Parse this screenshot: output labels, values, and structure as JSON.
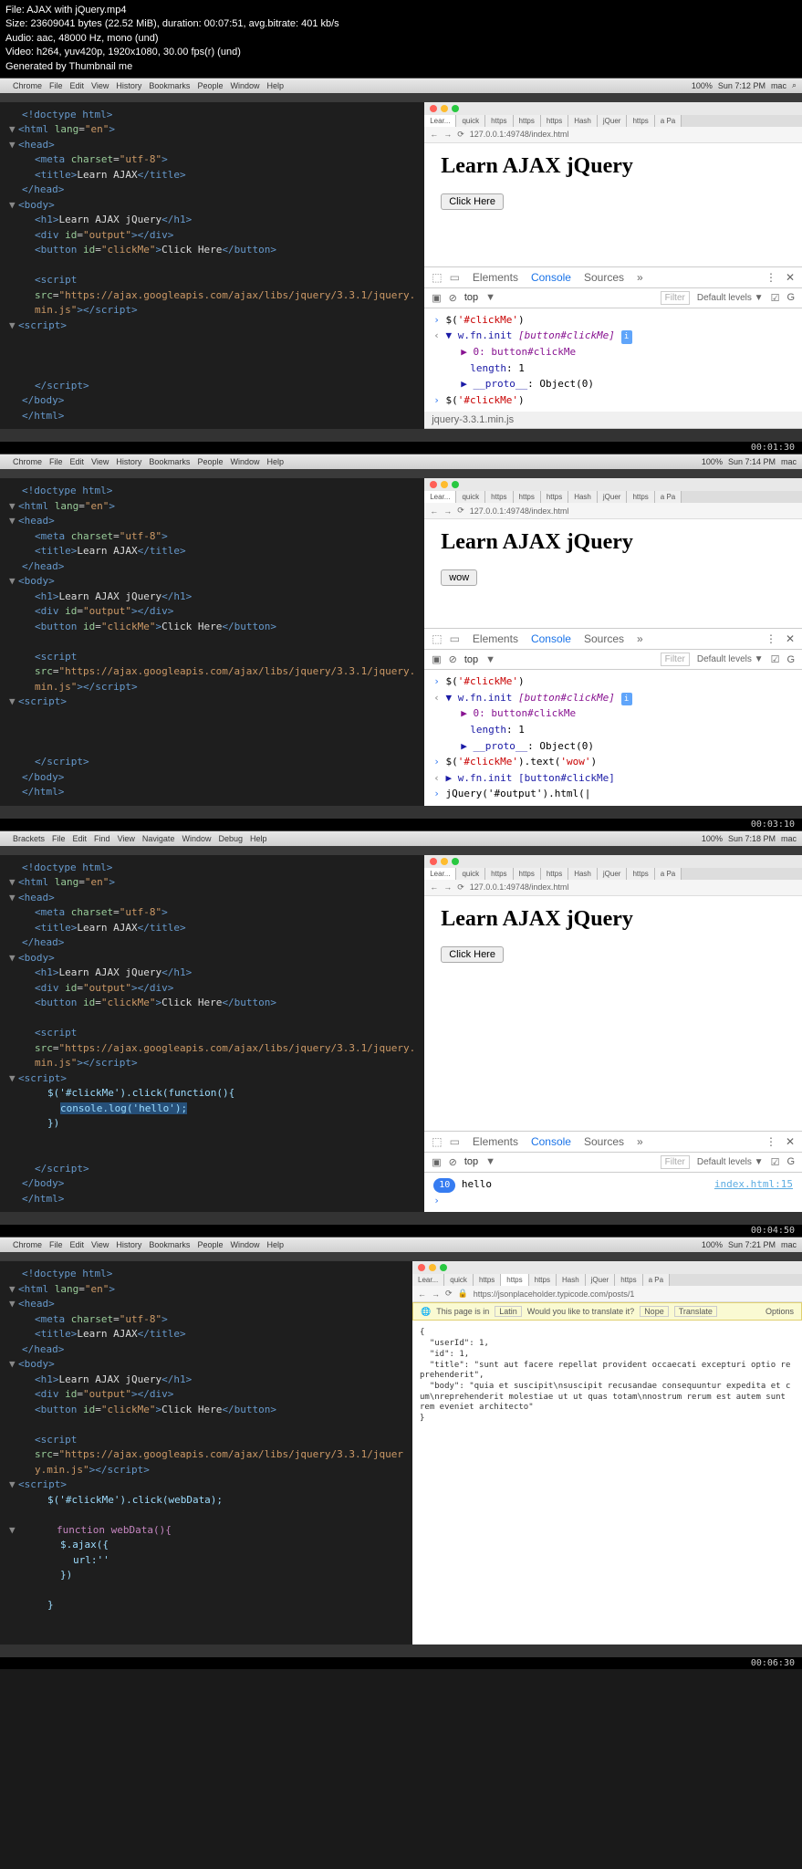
{
  "header": {
    "file": "File: AJAX with jQuery.mp4",
    "size": "Size: 23609041 bytes (22.52 MiB), duration: 00:07:51, avg.bitrate: 401 kb/s",
    "audio": "Audio: aac, 48000 Hz, mono (und)",
    "video": "Video: h264, yuv420p, 1920x1080, 30.00 fps(r) (und)",
    "gen": "Generated by Thumbnail me"
  },
  "menu": {
    "apple": "",
    "items": [
      "Chrome",
      "File",
      "Edit",
      "View",
      "History",
      "Bookmarks",
      "People",
      "Window",
      "Help"
    ],
    "brackets_items": [
      "Brackets",
      "File",
      "Edit",
      "Find",
      "View",
      "Navigate",
      "Window",
      "Debug",
      "Help"
    ],
    "right_items": [
      "100%",
      "Sun 7:12 PM",
      "mac"
    ],
    "right_items2": [
      "100%",
      "Sun 7:14 PM",
      "mac"
    ],
    "right_items3": [
      "100%",
      "Sun 7:18 PM",
      "mac"
    ],
    "right_items4": [
      "100%",
      "Sun 7:21 PM",
      "mac"
    ]
  },
  "browser": {
    "tabs": [
      "Lear...",
      "quick",
      "https",
      "https",
      "https",
      "Hash",
      "jQuer",
      "https",
      "a Pa"
    ],
    "url": "127.0.0.1:49748/index.html",
    "url4": "https://jsonplaceholder.typicode.com/posts/1"
  },
  "page": {
    "h1": "Learn AJAX jQuery",
    "btn": "Click Here",
    "wow": "wow"
  },
  "devtools": {
    "elements": "Elements",
    "console": "Console",
    "sources": "Sources",
    "top": "top",
    "filter": "Filter",
    "levels": "Default levels ▼",
    "gear": "G"
  },
  "console1": {
    "l1a": "$(",
    "l1b": "'#clickMe'",
    "l1c": ")",
    "l2a": "▼ w.fn.init ",
    "l2b": "[button#clickMe]",
    "l3": "▶ 0: button#clickMe",
    "l4a": "length",
    "l4b": ": 1",
    "l5a": "▶ __proto__",
    "l5b": ": Object(0)",
    "l6a": "$(",
    "l6b": "'#clickMe'",
    "l6c": ")"
  },
  "console2": {
    "e1": "$('#clickMe').text('wow')",
    "e2": "▶ w.fn.init [button#clickMe]",
    "e3": "jQuery('#output').html(|"
  },
  "console3": {
    "count": "10",
    "msg": "hello",
    "link": "index.html:15"
  },
  "code": {
    "doctype": "<!doctype html>",
    "html_open": "html",
    "lang": "lang",
    "en": "\"en\"",
    "head": "head",
    "meta": "meta",
    "charset": "charset",
    "utf8": "\"utf-8\"",
    "title": "title",
    "title_txt": "Learn AJAX",
    "body": "body",
    "h1": "h1",
    "h1_txt": "Learn AJAX jQuery",
    "div": "div",
    "id": "id",
    "output": "\"output\"",
    "button": "button",
    "clickme": "\"clickMe\"",
    "btn_txt": "Click Here",
    "script": "script",
    "src": "src",
    "jquery_url": "\"https://ajax.googleapis.com/ajax/libs/jquery/3.3.1/jquery.min.js\"",
    "jquery_url_short": "\"https://ajax.googleapis.com/ajax/libs/jquery/3.3.1/jquery.",
    "jquery_url_wrap": "\"https://ajax.googleapis.com/ajax/libs/jquery/3.3.1/jquer",
    "minjs": "min.js\"",
    "ymin": "y.min.js\"",
    "js3a": "$('#clickMe').click(function(){",
    "js3b": "console.log('hello');",
    "js3c": "})",
    "js4a": "$('#clickMe').click(webData);",
    "js4b": "function webData(){",
    "js4c": "$.ajax({",
    "js4d": "url:''",
    "js4e": "})",
    "js4f": "}"
  },
  "translate": {
    "text": "This page is in",
    "lang": "Latin",
    "q": "Would you like to translate it?",
    "nope": "Nope",
    "trans": "Translate",
    "opts": "Options"
  },
  "json4": "{\n  \"userId\": 1,\n  \"id\": 1,\n  \"title\": \"sunt aut facere repellat provident occaecati excepturi optio reprehenderit\",\n  \"body\": \"quia et suscipit\\nsuscipit recusandae consequuntur expedita et cum\\nreprehenderit molestiae ut ut quas totam\\nnostrum rerum est autem sunt rem eveniet architecto\"\n}",
  "timestamps": {
    "t1": "00:01:30",
    "t2": "00:03:10",
    "t3": "00:04:50",
    "t4": "00:06:30"
  },
  "bottomfile": "jquery-3.3.1.min.js"
}
